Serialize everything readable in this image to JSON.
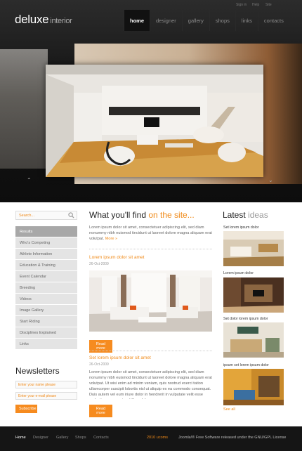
{
  "header": {
    "logo_main": "deluxe",
    "logo_sub": "interior",
    "top_links": [
      "Sign in",
      "Help",
      "Site"
    ],
    "nav": [
      "home",
      "designer",
      "gallery",
      "shops",
      "links",
      "contacts"
    ]
  },
  "slider": {
    "prev_icon": "chevron-up",
    "next_icon": "chevron-down"
  },
  "sidebar": {
    "search_placeholder": "Search...",
    "menu": [
      "Results",
      "Who's Competing",
      "Athlete Information",
      "Education & Training",
      "Event Calendar",
      "Breeding",
      "Videos",
      "Image Gallery",
      "Start Riding",
      "Disciplines Explained",
      "Links"
    ],
    "newsletter_title": "Newsletters",
    "name_placeholder": "Enter your name please",
    "email_placeholder": "Enter your e-mail please",
    "subscribe_label": "Subscribe"
  },
  "center": {
    "title_main": "What you'll find",
    "title_hl": "on the site...",
    "intro": "Lorem ipsum dolor sit amet, consectetuer adipiscing elit, sed diam nonummy nibh euismod tincidunt ut laoreet dolore magna aliquam erat volutpat.",
    "intro_more": "More",
    "article1_title": "Lorem ipsum dolor sit amet",
    "article1_date": "26-Oct-2009",
    "read_more": "Read more",
    "article2_title": "Set lorem ipsum dolor sit amet",
    "article2_date": "26-Oct-2009",
    "article2_text": "Lorem ipsum dolor sit amet, consectetuer adipiscing elit, sed diam nonummy nibh euismod tincidunt ut laoreet dolore magna aliquam erat volutpat. Ut wisi enim ad minim veniam, quis nostrud exerci tation ullamcorper suscipit lobortis nisl ut aliquip ex ea commodo consequat. Duis autem vel eum iriure dolor in hendrerit in vulputate velit esse molestie consequat, vel illum dol"
  },
  "right": {
    "title_main": "Latest",
    "title_hl": "ideas",
    "captions": [
      "Set lorem ipsum dolor",
      "Lorem ipsum dolor",
      "Set dolor lorem ipsum dolor",
      "ipsum set lorem ipsum dolor"
    ],
    "see_all": "See all"
  },
  "footer": {
    "nav": [
      "Home",
      "Designer",
      "Gallery",
      "Shops",
      "Contacts"
    ],
    "copyright": "2010 ucoms",
    "license": "Joomla!® Free Software released under the GNU/GPL License"
  }
}
